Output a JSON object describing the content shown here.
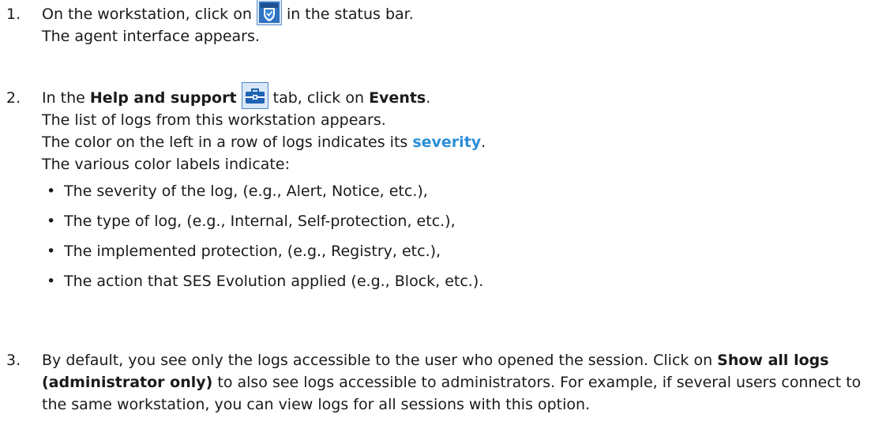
{
  "steps": [
    {
      "number": "1.",
      "line1_before": "On the workstation, click on ",
      "line1_after": " in the status bar.",
      "icon": "agent-shield-icon",
      "line2": "The agent interface appears."
    },
    {
      "number": "2.",
      "line1_a": "In the ",
      "tab_name": "Help and support",
      "line1_b": " tab, click on ",
      "events": "Events",
      "line1_c": ".",
      "icon": "toolbox-icon",
      "line2": "The list of logs from this workstation appears.",
      "line3_before": "The color on the left in a row of logs indicates its ",
      "severity_link": "severity",
      "line3_after": ".",
      "line4": "The various color labels indicate:",
      "bullets": [
        "The severity of the log, (e.g., Alert, Notice, etc.),",
        "The type of log, (e.g., Internal, Self-protection, etc.),",
        "The implemented protection, (e.g., Registry, etc.),",
        "The action that SES Evolution applied (e.g., Block, etc.)."
      ]
    },
    {
      "number": "3.",
      "text_a": "By default, you see only the logs accessible to the user who opened the session. Click on ",
      "bold": "Show all logs (administrator only)",
      "text_b": " to also see logs accessible to administrators. For example, if several users connect to the same workstation, you can view logs for all sessions with this option."
    }
  ],
  "colors": {
    "link": "#2a8fd6",
    "icon_blue": "#1e5fa8"
  }
}
